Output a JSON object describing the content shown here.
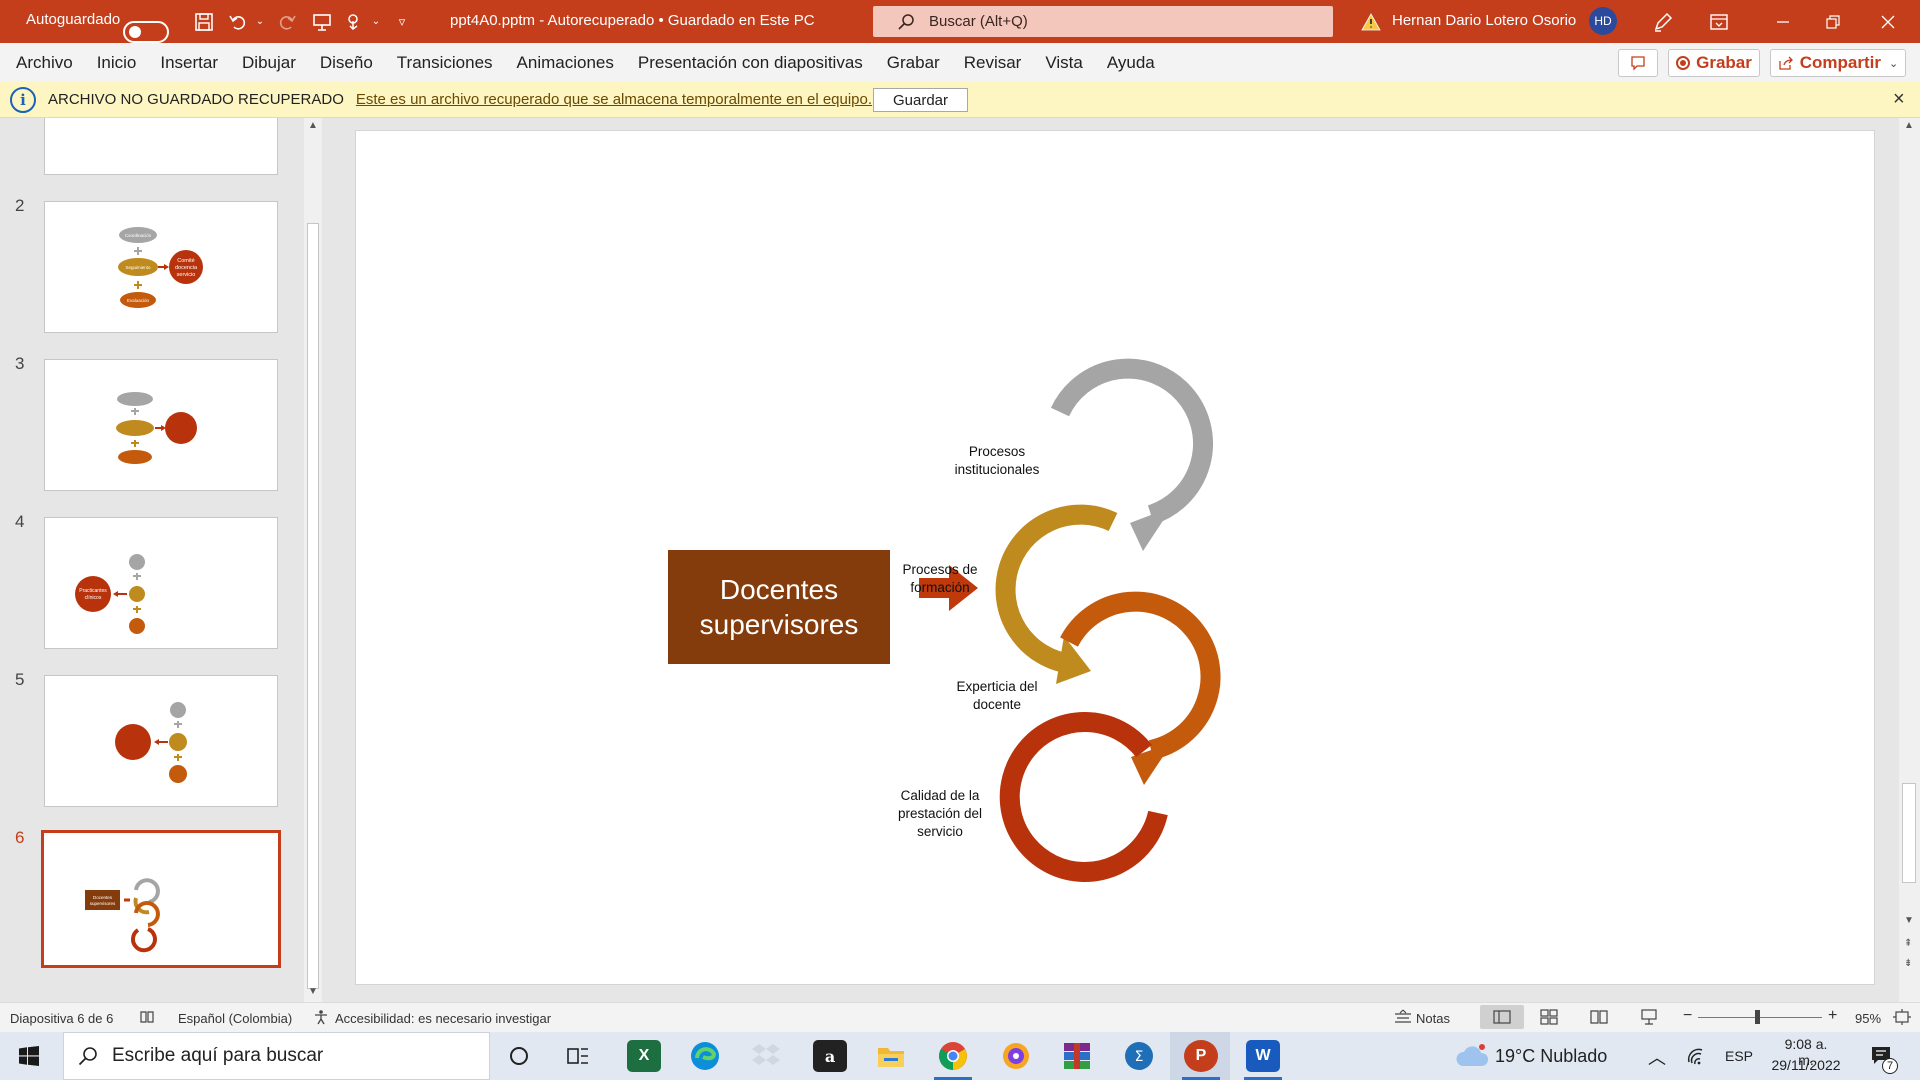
{
  "titlebar": {
    "autosave_label": "Autoguardado",
    "file_title": "ppt4A0.pptm  -  Autorecuperado • Guardado en Este PC",
    "search_placeholder": "Buscar (Alt+Q)",
    "user_name": "Hernan Dario Lotero Osorio",
    "user_initials": "HD",
    "accent_color": "#c43e1c"
  },
  "menu": {
    "items": [
      "Archivo",
      "Inicio",
      "Insertar",
      "Dibujar",
      "Diseño",
      "Transiciones",
      "Animaciones",
      "Presentación con diapositivas",
      "Grabar",
      "Revisar",
      "Vista",
      "Ayuda"
    ],
    "record_label": "Grabar",
    "share_label": "Compartir"
  },
  "infobar": {
    "title": "ARCHIVO NO GUARDADO RECUPERADO",
    "message": "Este es un archivo recuperado que se almacena temporalmente en el equipo.",
    "save_button": "Guardar",
    "close": "×"
  },
  "thumbnails": {
    "numbers": [
      "2",
      "3",
      "4",
      "5",
      "6"
    ],
    "active": "6",
    "t2_top": "Coordinación",
    "t2_mid": "Seguimiento",
    "t2_right_1": "Comité",
    "t2_right_2": "docencia",
    "t2_right_3": "servicio",
    "t2_bottom": "Evaluación",
    "t4_left_1": "Practicantes",
    "t4_left_2": "clínicos",
    "t6_box_1": "Docentes",
    "t6_box_2": "supervisores"
  },
  "slide": {
    "box_line1": "Docentes",
    "box_line2": "supervisores",
    "cycle": [
      {
        "line1": "Procesos",
        "line2": "institucionales",
        "line3": "",
        "color": "#a5a5a5"
      },
      {
        "line1": "Procesos de",
        "line2": "formación",
        "line3": "",
        "color": "#bf8a1e"
      },
      {
        "line1": "Experticia del",
        "line2": "docente",
        "line3": "",
        "color": "#c45a0c"
      },
      {
        "line1": "Calidad de la",
        "line2": "prestación del",
        "line3": "servicio",
        "color": "#b8330c"
      }
    ],
    "box_color": "#843c0c",
    "arrow_color": "#c0390b"
  },
  "status": {
    "slide_info": "Diapositiva 6 de 6",
    "language": "Español (Colombia)",
    "accessibility": "Accesibilidad: es necesario investigar",
    "notes": "Notas",
    "zoom": "95%"
  },
  "taskbar": {
    "search_placeholder": "Escribe aquí para buscar",
    "weather": "19°C  Nublado",
    "lang": "ESP",
    "time": "9:08 a. m.",
    "date": "29/11/2022",
    "notif_count": "7"
  }
}
